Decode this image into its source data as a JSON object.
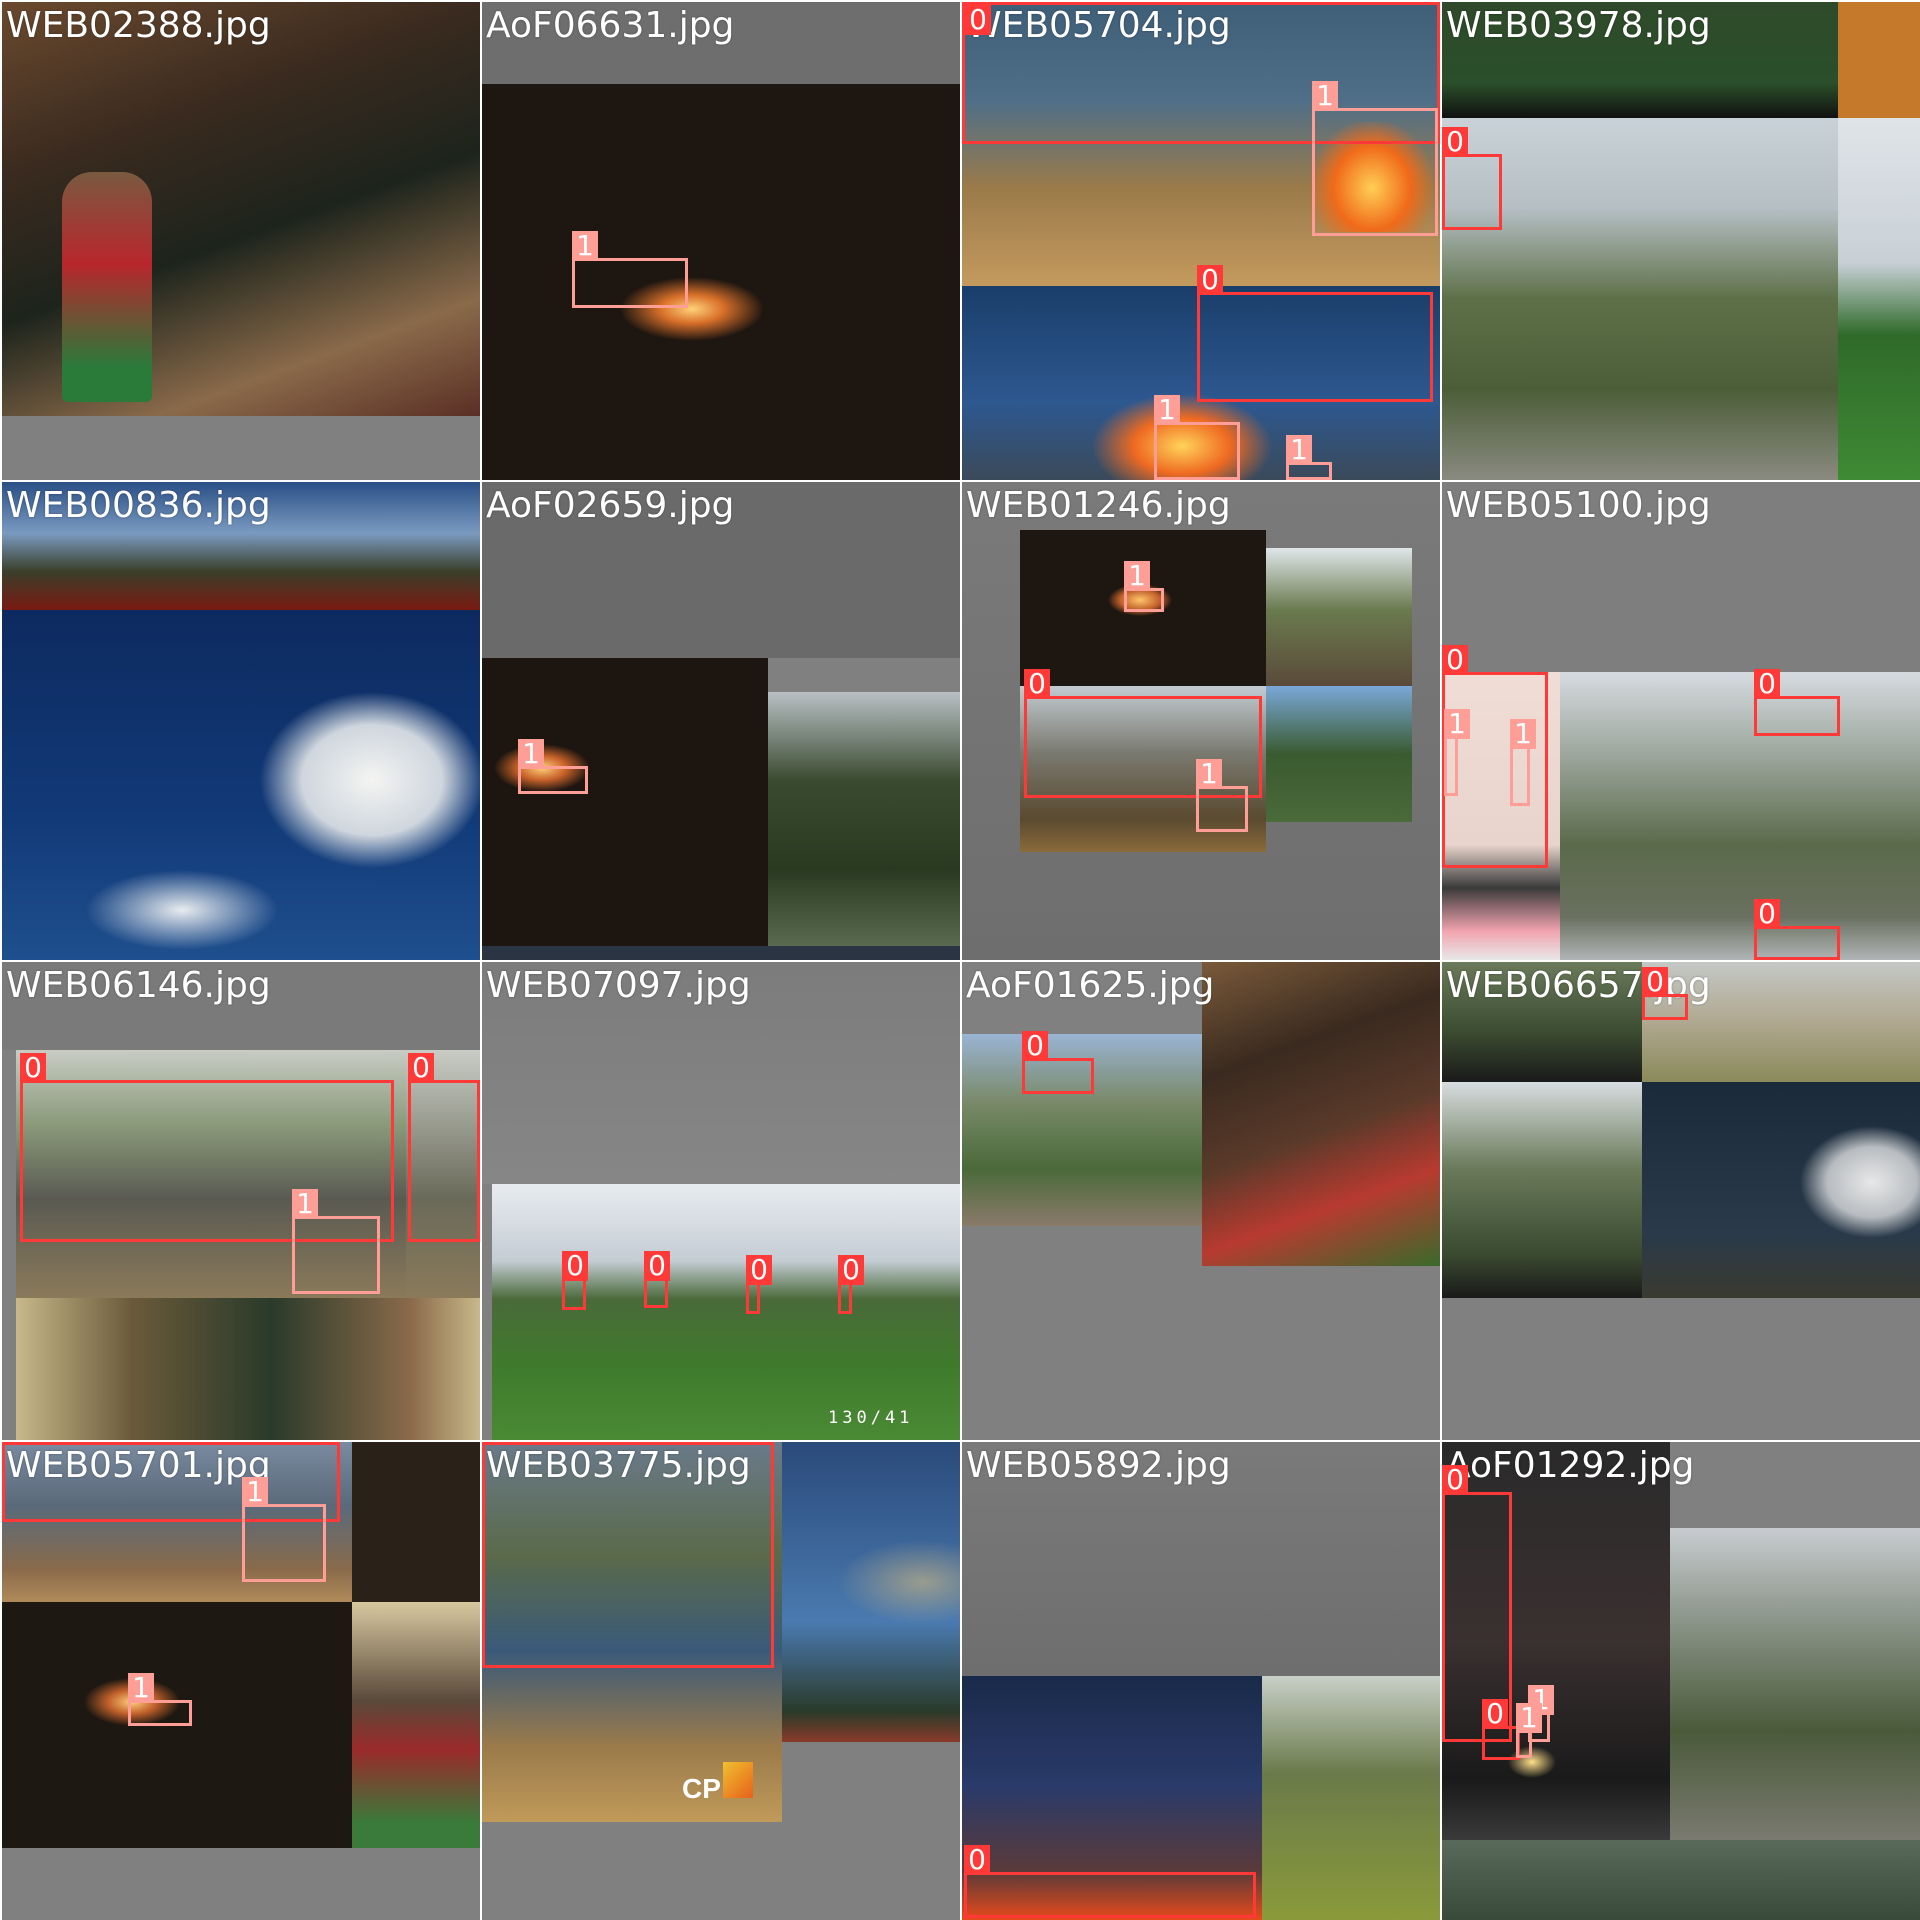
{
  "mosaic": {
    "tiles": [
      {
        "filename": "WEB02388.jpg"
      },
      {
        "filename": "AoF06631.jpg"
      },
      {
        "filename": "WEB05704.jpg"
      },
      {
        "filename": "WEB03978.jpg"
      },
      {
        "filename": "WEB00836.jpg"
      },
      {
        "filename": "AoF02659.jpg"
      },
      {
        "filename": "WEB01246.jpg"
      },
      {
        "filename": "WEB05100.jpg"
      },
      {
        "filename": "WEB06146.jpg"
      },
      {
        "filename": "WEB07097.jpg"
      },
      {
        "filename": "AoF01625.jpg"
      },
      {
        "filename": "WEB06657.jpg"
      },
      {
        "filename": "WEB05701.jpg"
      },
      {
        "filename": "WEB03775.jpg"
      },
      {
        "filename": "WEB05892.jpg"
      },
      {
        "filename": "AoF01292.jpg"
      }
    ],
    "class_labels": {
      "smoke": "0",
      "fire": "1"
    },
    "colors": {
      "class_0": "#ff3838",
      "class_1": "#ff9d97",
      "padding_gray": "#808080",
      "separator": "#ffffff"
    },
    "watermarks": {
      "frame_counter": "130/41",
      "cp_logo": "CP"
    }
  }
}
